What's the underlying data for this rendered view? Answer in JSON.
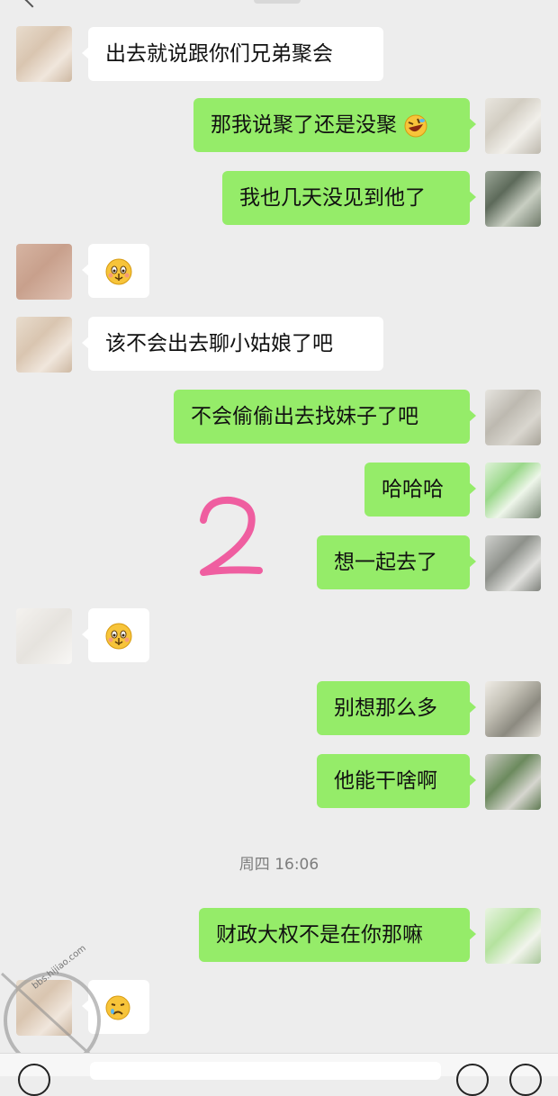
{
  "chat": {
    "messages": [
      {
        "side": "recv",
        "text": "出去就说跟你们兄弟聚会"
      },
      {
        "side": "sent",
        "text": "那我说聚了还是没聚",
        "emoji": "rolling-laughing-emoji"
      },
      {
        "side": "sent",
        "text": "我也几天没见到他了"
      },
      {
        "side": "recv",
        "text": "",
        "emoji": "smirk-emoji"
      },
      {
        "side": "recv",
        "text": "该不会出去聊小姑娘了吧"
      },
      {
        "side": "sent",
        "text": "不会偷偷出去找妹子了吧"
      },
      {
        "side": "sent",
        "text": "哈哈哈"
      },
      {
        "side": "sent",
        "text": "想一起去了"
      },
      {
        "side": "recv",
        "text": "",
        "emoji": "smirk-emoji"
      },
      {
        "side": "sent",
        "text": "别想那么多"
      },
      {
        "side": "sent",
        "text": "他能干啥啊"
      },
      {
        "side": "sent",
        "text": "财政大权不是在你那嘛"
      },
      {
        "side": "recv",
        "text": "",
        "emoji": "sad-face-emoji"
      }
    ],
    "timestamp": "周四 16:06"
  },
  "annotation": {
    "text": "2",
    "color": "#ef5ea0"
  },
  "watermark": {
    "text": "bbs.hijiao.com"
  },
  "colors": {
    "background": "#ededed",
    "sent_bubble": "#95ec69",
    "recv_bubble": "#ffffff"
  }
}
